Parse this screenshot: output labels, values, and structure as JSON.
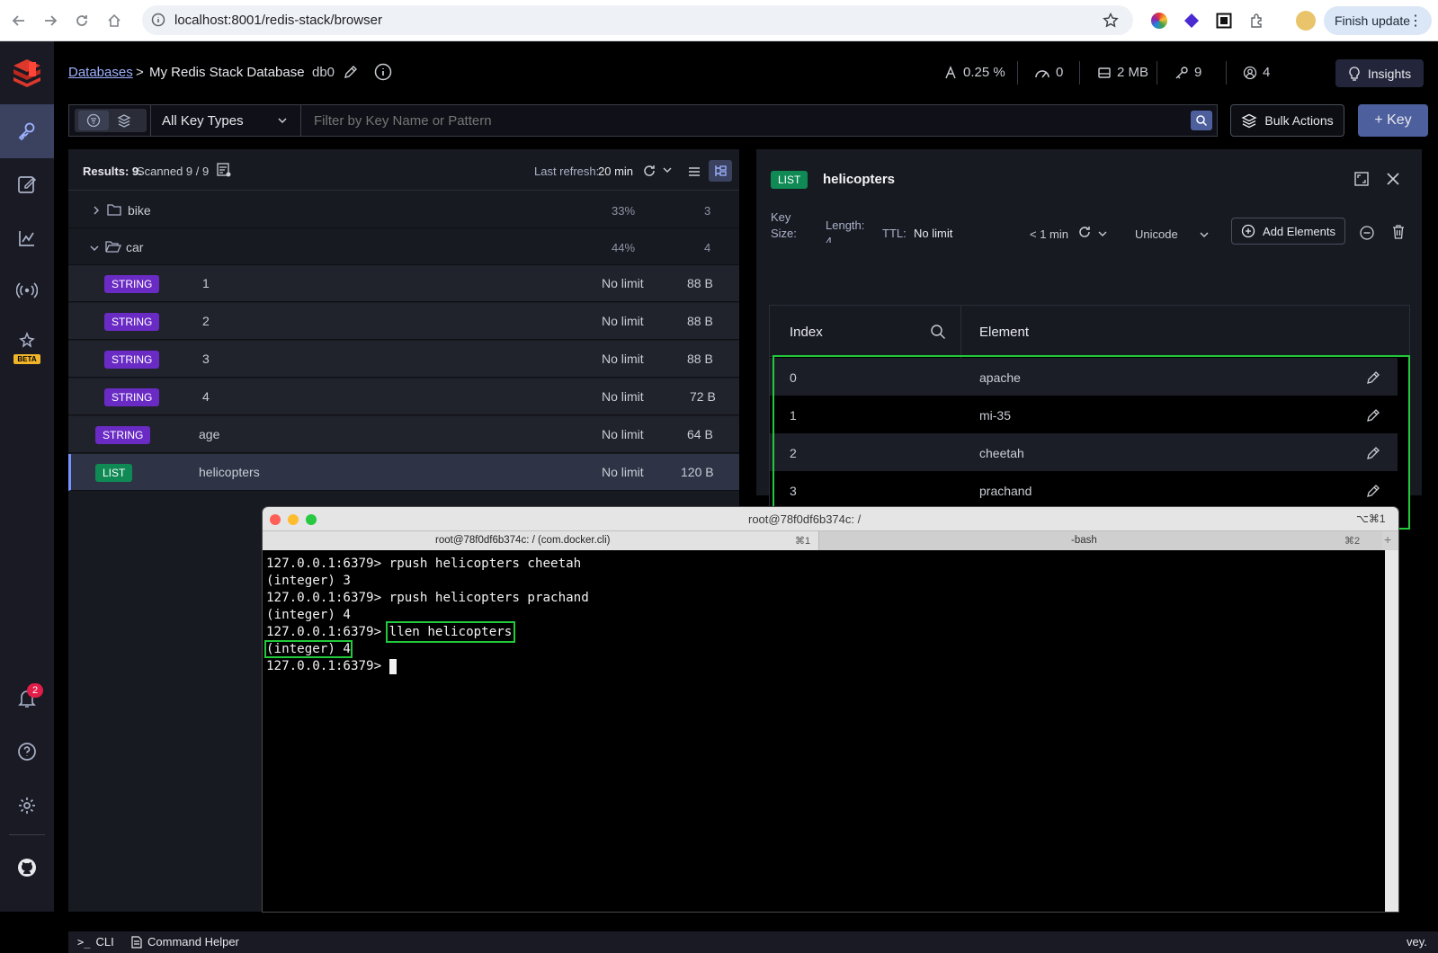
{
  "browser": {
    "url": "localhost:8001/redis-stack/browser",
    "finish_update": "Finish update"
  },
  "header": {
    "breadcrumb_databases": "Databases",
    "breadcrumb_sep": ">",
    "db_name": "My Redis Stack Database",
    "db_index": "db0",
    "stats": {
      "cpu": "0.25 %",
      "ops": "0",
      "memory": "2 MB",
      "keys": "9",
      "clients": "4"
    },
    "insights_label": "Insights"
  },
  "filter": {
    "key_type": "All Key Types",
    "search_placeholder": "Filter by Key Name or Pattern",
    "bulk_actions": "Bulk Actions",
    "add_key": "+ Key"
  },
  "keylist": {
    "results": "Results: 9.",
    "scanned": "Scanned 9 / 9",
    "last_refresh_label": "Last refresh:",
    "last_refresh_value": "20 min",
    "folders": [
      {
        "name": "bike",
        "percent": "33%",
        "count": "3"
      },
      {
        "name": "car",
        "percent": "44%",
        "count": "4"
      }
    ],
    "keys": [
      {
        "type": "STRING",
        "name": "1",
        "ttl": "No limit",
        "size": "88 B"
      },
      {
        "type": "STRING",
        "name": "2",
        "ttl": "No limit",
        "size": "88 B"
      },
      {
        "type": "STRING",
        "name": "3",
        "ttl": "No limit",
        "size": "88 B"
      },
      {
        "type": "STRING",
        "name": "4",
        "ttl": "No limit",
        "size": "72 B"
      },
      {
        "type": "STRING",
        "name": "age",
        "ttl": "No limit",
        "size": "64 B"
      },
      {
        "type": "LIST",
        "name": "helicopters",
        "ttl": "No limit",
        "size": "120 B"
      }
    ]
  },
  "details": {
    "type": "LIST",
    "key_name": "helicopters",
    "key_size_label_1": "Key",
    "key_size_label_2": "Size:",
    "length_label": "Length:",
    "length_value": "4",
    "ttl_label": "TTL:",
    "ttl_value": "No limit",
    "refresh_time": "< 1 min",
    "encoding": "Unicode",
    "add_elements": "Add Elements",
    "col_index": "Index",
    "col_element": "Element",
    "rows": [
      {
        "index": "0",
        "element": "apache"
      },
      {
        "index": "1",
        "element": "mi-35"
      },
      {
        "index": "2",
        "element": "cheetah"
      },
      {
        "index": "3",
        "element": "prachand"
      }
    ]
  },
  "terminal": {
    "title": "root@78f0df6b374c: /",
    "shortcut": "⌥⌘1",
    "tab1_label": "root@78f0df6b374c: / (com.docker.cli)",
    "tab1_shortcut": "⌘1",
    "tab2_label": "-bash",
    "tab2_shortcut": "⌘2",
    "lines": [
      "127.0.0.1:6379> rpush helicopters cheetah",
      "(integer) 3",
      "127.0.0.1:6379> rpush helicopters prachand",
      "(integer) 4"
    ],
    "prompt": "127.0.0.1:6379> ",
    "command": "llen helicopters",
    "result": "(integer) 4",
    "final_prompt": "127.0.0.1:6379> "
  },
  "sidebar": {
    "beta": "BETA",
    "notifications_count": "2"
  },
  "bottombar": {
    "cli": "CLI",
    "command_helper": "Command Helper",
    "survey_fragment": "vey."
  },
  "colors": {
    "accent": "#7893ff",
    "string_badge": "#6a2bc4",
    "list_badge": "#0f8a55",
    "highlight": "#22c93a",
    "redis_red": "#dc382c"
  }
}
